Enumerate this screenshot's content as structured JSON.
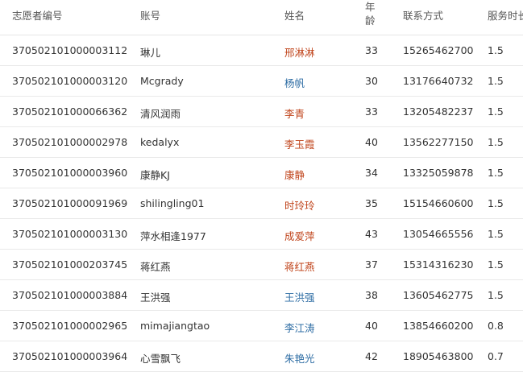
{
  "headers": {
    "volunteer_id": "志愿者编号",
    "account": "账号",
    "name": "姓名",
    "age_top": "年",
    "age_bottom": "龄",
    "contact": "联系方式",
    "service_hours": "服务时长"
  },
  "colors": {
    "name_red": "#c0441b",
    "name_blue": "#2e6da4",
    "row_border": "#e9e9e9"
  },
  "rows": [
    {
      "id": "370502101000003112",
      "account": "琳儿",
      "name": "邢淋淋",
      "name_color": "red",
      "age": "33",
      "phone": "15265462700",
      "hours": "1.5"
    },
    {
      "id": "370502101000003120",
      "account": "Mcgrady",
      "name": "杨帆",
      "name_color": "blue",
      "age": "30",
      "phone": "13176640732",
      "hours": "1.5"
    },
    {
      "id": "370502101000066362",
      "account": "清风润雨",
      "name": "李青",
      "name_color": "red",
      "age": "33",
      "phone": "13205482237",
      "hours": "1.5"
    },
    {
      "id": "370502101000002978",
      "account": "kedalyx",
      "name": "李玉霞",
      "name_color": "red",
      "age": "40",
      "phone": "13562277150",
      "hours": "1.5"
    },
    {
      "id": "370502101000003960",
      "account": "康静KJ",
      "name": "康静",
      "name_color": "red",
      "age": "34",
      "phone": "13325059878",
      "hours": "1.5"
    },
    {
      "id": "370502101000091969",
      "account": "shilingling01",
      "name": "时玲玲",
      "name_color": "red",
      "age": "35",
      "phone": "15154660600",
      "hours": "1.5"
    },
    {
      "id": "370502101000003130",
      "account": "萍水相逢1977",
      "name": "成爱萍",
      "name_color": "red",
      "age": "43",
      "phone": "13054665556",
      "hours": "1.5"
    },
    {
      "id": "370502101000203745",
      "account": "蒋红燕",
      "name": "蒋红燕",
      "name_color": "red",
      "age": "37",
      "phone": "15314316230",
      "hours": "1.5"
    },
    {
      "id": "370502101000003884",
      "account": "王洪强",
      "name": "王洪强",
      "name_color": "blue",
      "age": "38",
      "phone": "13605462775",
      "hours": "1.5"
    },
    {
      "id": "370502101000002965",
      "account": "mimajiangtao",
      "name": "李江涛",
      "name_color": "blue",
      "age": "40",
      "phone": "13854660200",
      "hours": "0.8"
    },
    {
      "id": "370502101000003964",
      "account": "心雪飘飞",
      "name": "朱艳光",
      "name_color": "blue",
      "age": "42",
      "phone": "18905463800",
      "hours": "0.7"
    }
  ]
}
